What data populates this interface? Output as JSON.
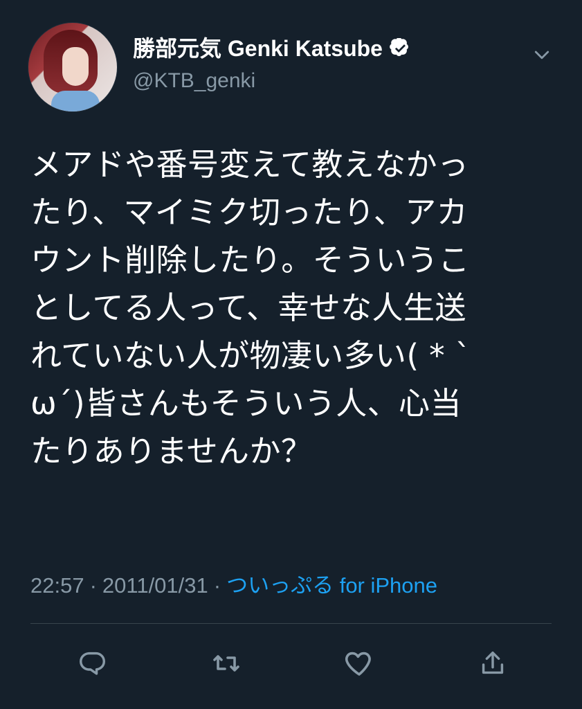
{
  "tweet": {
    "user": {
      "display_name": "勝部元気 Genki Katsube",
      "handle": "@KTB_genki",
      "verified_icon": "verified-badge-icon"
    },
    "menu_icon": "chevron-down-icon",
    "text": "メアドや番号変えて教えなかっ\nたり、マイミク切ったり、アカ\nウント削除したり。そういうこ\nとしてる人って、幸せな人生送\nれていない人が物凄い多い( * `\nω´)皆さんもそういう人、心当\nたりありませんか？",
    "time": "22:57",
    "separator_1": "·",
    "date": "2011/01/31",
    "separator_2": "·",
    "source": "ついっぷる for iPhone",
    "actions": [
      {
        "name": "reply-icon"
      },
      {
        "name": "retweet-icon"
      },
      {
        "name": "like-icon"
      },
      {
        "name": "share-icon"
      }
    ],
    "colors": {
      "background": "#15202b",
      "text": "#ffffff",
      "secondary": "#8899a6",
      "link": "#1da1f2"
    }
  }
}
